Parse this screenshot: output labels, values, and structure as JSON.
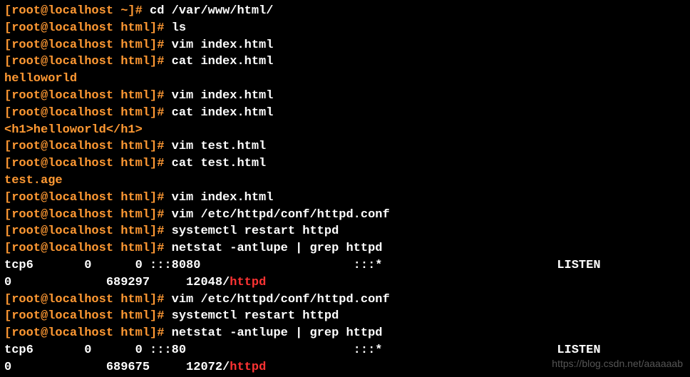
{
  "lines": [
    {
      "prompt": "[root@localhost ~]# ",
      "command": "cd /var/www/html/"
    },
    {
      "prompt": "[root@localhost html]# ",
      "command": "ls"
    },
    {
      "prompt": "[root@localhost html]# ",
      "command": "vim index.html"
    },
    {
      "prompt": "[root@localhost html]# ",
      "command": "cat index.html"
    },
    {
      "output": "helloworld"
    },
    {
      "prompt": "[root@localhost html]# ",
      "command": "vim index.html"
    },
    {
      "prompt": "[root@localhost html]# ",
      "command": "cat index.html"
    },
    {
      "output": "<h1>helloworld</h1>"
    },
    {
      "prompt": "[root@localhost html]# ",
      "command": "vim test.html"
    },
    {
      "prompt": "[root@localhost html]# ",
      "command": "cat test.html"
    },
    {
      "output": "test.age"
    },
    {
      "prompt": "[root@localhost html]# ",
      "command": "vim index.html"
    },
    {
      "prompt": "[root@localhost html]# ",
      "command": "vim /etc/httpd/conf/httpd.conf"
    },
    {
      "prompt": "[root@localhost html]# ",
      "command": "systemctl restart httpd"
    },
    {
      "prompt": "[root@localhost html]# ",
      "command": "netstat -antlupe | grep httpd"
    },
    {
      "netstat": {
        "proto": "tcp6",
        "recvq": "0",
        "sendq": "0",
        "local": ":::8080",
        "foreign": ":::*",
        "state": "LISTEN"
      }
    },
    {
      "netstat2": {
        "col1": "0",
        "col2": "689297",
        "pid": "12048/",
        "proc": "httpd"
      }
    },
    {
      "prompt": "[root@localhost html]# ",
      "command": "vim /etc/httpd/conf/httpd.conf"
    },
    {
      "prompt": "[root@localhost html]# ",
      "command": "systemctl restart httpd"
    },
    {
      "prompt": "[root@localhost html]# ",
      "command": "netstat -antlupe | grep httpd"
    },
    {
      "netstat": {
        "proto": "tcp6",
        "recvq": "0",
        "sendq": "0",
        "local": ":::80",
        "foreign": ":::*",
        "state": "LISTEN"
      }
    },
    {
      "netstat2": {
        "col1": "0",
        "col2": "689675",
        "pid": "12072/",
        "proc": "httpd"
      }
    }
  ],
  "watermark": "https://blog.csdn.net/aaaaaab"
}
